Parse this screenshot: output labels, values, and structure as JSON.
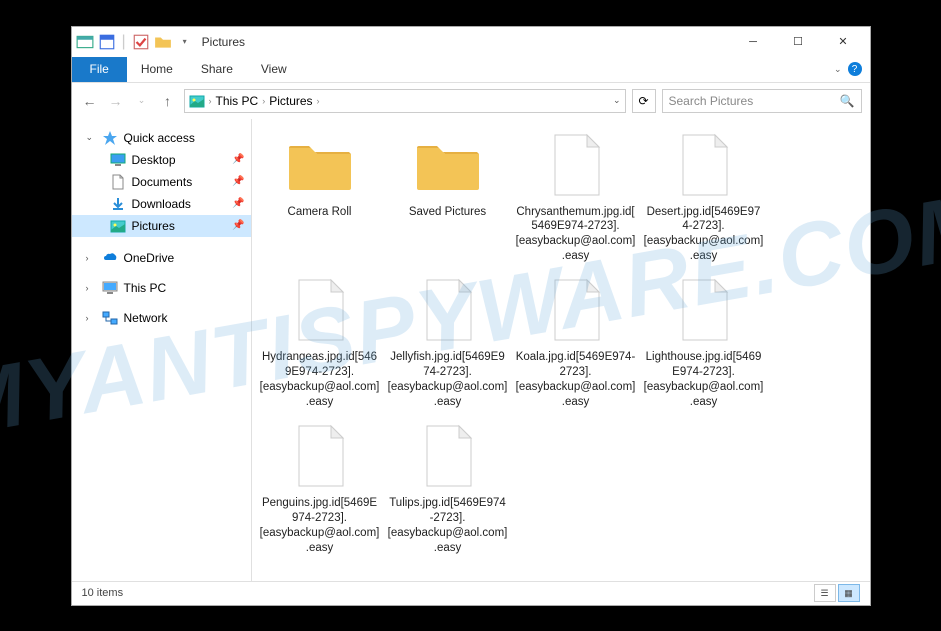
{
  "title": "Pictures",
  "ribbon": {
    "file": "File",
    "tabs": [
      "Home",
      "Share",
      "View"
    ]
  },
  "breadcrumb": {
    "items": [
      "This PC",
      "Pictures"
    ]
  },
  "search": {
    "placeholder": "Search Pictures"
  },
  "nav": {
    "quick": {
      "label": "Quick access",
      "items": [
        {
          "label": "Desktop",
          "pin": true
        },
        {
          "label": "Documents",
          "pin": true
        },
        {
          "label": "Downloads",
          "pin": true
        },
        {
          "label": "Pictures",
          "pin": true,
          "selected": true
        }
      ]
    },
    "onedrive": "OneDrive",
    "thispc": "This PC",
    "network": "Network"
  },
  "items": [
    {
      "type": "folder",
      "label": "Camera Roll"
    },
    {
      "type": "folder",
      "label": "Saved Pictures"
    },
    {
      "type": "file",
      "label": "Chrysanthemum.jpg.id[5469E974-2723].[easybackup@aol.com].easy"
    },
    {
      "type": "file",
      "label": "Desert.jpg.id[5469E974-2723].[easybackup@aol.com].easy"
    },
    {
      "type": "file",
      "label": "Hydrangeas.jpg.id[5469E974-2723].[easybackup@aol.com].easy"
    },
    {
      "type": "file",
      "label": "Jellyfish.jpg.id[5469E974-2723].[easybackup@aol.com].easy"
    },
    {
      "type": "file",
      "label": "Koala.jpg.id[5469E974-2723].[easybackup@aol.com].easy"
    },
    {
      "type": "file",
      "label": "Lighthouse.jpg.id[5469E974-2723].[easybackup@aol.com].easy"
    },
    {
      "type": "file",
      "label": "Penguins.jpg.id[5469E974-2723].[easybackup@aol.com].easy"
    },
    {
      "type": "file",
      "label": "Tulips.jpg.id[5469E974-2723].[easybackup@aol.com].easy"
    }
  ],
  "status": {
    "count": "10 items"
  },
  "watermark": "MYANTISPYWARE.COM"
}
